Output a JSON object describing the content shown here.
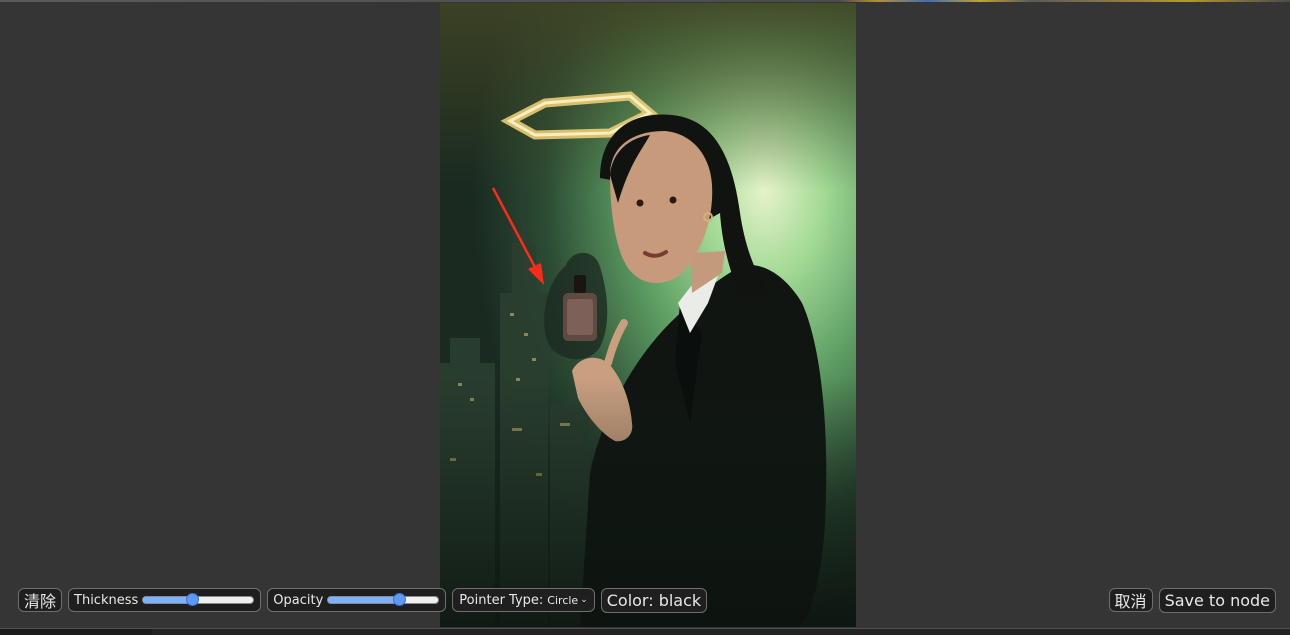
{
  "toolbar": {
    "clear_label": "清除",
    "thickness": {
      "label": "Thickness",
      "value": 0.45
    },
    "opacity": {
      "label": "Opacity",
      "value": 0.65
    },
    "pointer_type": {
      "label": "Pointer Type:",
      "value": "Circle"
    },
    "color_label": "Color: black",
    "cancel_label": "取消",
    "save_label": "Save to node"
  },
  "colors": {
    "background": "#353535",
    "button_bg": "#1f1f1f",
    "slider_accent": "#5f98f6",
    "arrow": "#ff2a1a"
  },
  "icons": {
    "chevron": "chevron-down-icon",
    "annotation_arrow": "red-arrow-icon"
  }
}
